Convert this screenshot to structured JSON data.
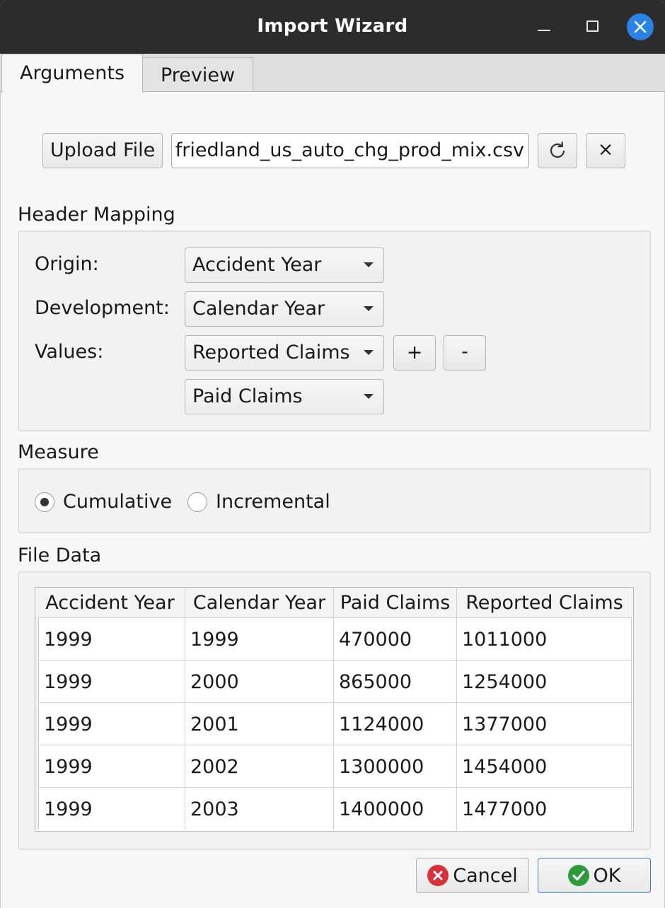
{
  "window": {
    "title": "Import Wizard"
  },
  "tabs": [
    {
      "label": "Arguments"
    },
    {
      "label": "Preview"
    }
  ],
  "file": {
    "upload_label": "Upload File",
    "filename": "friedland_us_auto_chg_prod_mix.csv",
    "reload_icon": "reload-icon",
    "clear_label": "×"
  },
  "header_mapping": {
    "title": "Header Mapping",
    "origin_label": "Origin:",
    "origin_value": "Accident Year",
    "development_label": "Development:",
    "development_value": "Calendar Year",
    "values_label": "Values:",
    "values": [
      "Reported Claims",
      "Paid Claims"
    ],
    "add_label": "+",
    "remove_label": "-"
  },
  "measure": {
    "title": "Measure",
    "options": [
      {
        "label": "Cumulative",
        "checked": true
      },
      {
        "label": "Incremental",
        "checked": false
      }
    ]
  },
  "file_data": {
    "title": "File Data",
    "columns": [
      "Accident Year",
      "Calendar Year",
      "Paid Claims",
      "Reported Claims"
    ],
    "rows": [
      [
        "1999",
        "1999",
        "470000",
        "1011000"
      ],
      [
        "1999",
        "2000",
        "865000",
        "1254000"
      ],
      [
        "1999",
        "2001",
        "1124000",
        "1377000"
      ],
      [
        "1999",
        "2002",
        "1300000",
        "1454000"
      ],
      [
        "1999",
        "2003",
        "1400000",
        "1477000"
      ]
    ]
  },
  "footer": {
    "cancel_label": "Cancel",
    "ok_label": "OK"
  },
  "colors": {
    "titlebar": "#2c2c2c",
    "close_button": "#2a82e4",
    "cancel_icon": "#d9303c",
    "ok_icon": "#2e9a3a",
    "ok_border": "#3a7fd0"
  }
}
